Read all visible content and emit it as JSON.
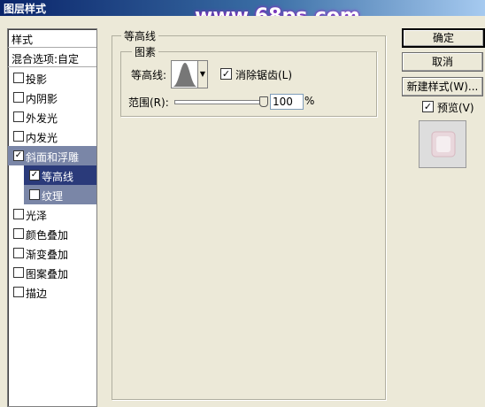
{
  "window": {
    "title": "图层样式",
    "watermark": "www.68ps.com"
  },
  "styles_list": {
    "header": "样式",
    "blend_options": "混合选项:自定",
    "items": [
      {
        "label": "投影",
        "checked": false
      },
      {
        "label": "内阴影",
        "checked": false
      },
      {
        "label": "外发光",
        "checked": false
      },
      {
        "label": "内发光",
        "checked": false
      },
      {
        "label": "斜面和浮雕",
        "checked": true,
        "selected": true
      },
      {
        "label": "等高线",
        "checked": true,
        "sub": true,
        "active": true
      },
      {
        "label": "纹理",
        "checked": false,
        "sub": true
      },
      {
        "label": "光泽",
        "checked": false
      },
      {
        "label": "颜色叠加",
        "checked": false
      },
      {
        "label": "渐变叠加",
        "checked": false
      },
      {
        "label": "图案叠加",
        "checked": false
      },
      {
        "label": "描边",
        "checked": false
      }
    ]
  },
  "contour_panel": {
    "group_title": "等高线",
    "subgroup_title": "图素",
    "contour_label": "等高线:",
    "anti_alias_label": "消除锯齿(L)",
    "anti_alias_checked": true,
    "range_label": "范围(R):",
    "range_value": "100",
    "range_unit": "%",
    "range_fraction": 1.0
  },
  "buttons": {
    "ok": "确定",
    "cancel": "取消",
    "new_style": "新建样式(W)...",
    "preview_label": "预览(V)",
    "preview_checked": true
  }
}
